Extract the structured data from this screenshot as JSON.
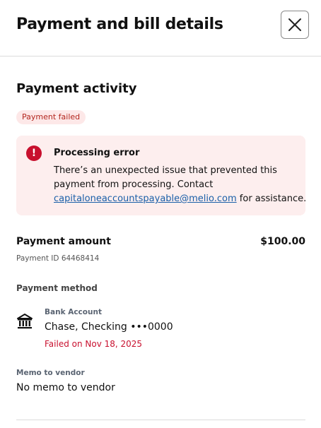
{
  "header": {
    "title": "Payment and bill details"
  },
  "activity": {
    "title": "Payment activity",
    "status_badge": "Payment failed",
    "error": {
      "title": "Processing error",
      "message_line1": "There’s an unexpected issue that prevented this",
      "message_line2": "payment from processing. Contact",
      "contact_email": "capitaloneaccountspayable@melio.com",
      "message_suffix": " for assistance."
    }
  },
  "payment": {
    "amount_label": "Payment amount",
    "amount_value": "$100.00",
    "payment_id": "Payment ID 64468414",
    "method_label": "Payment method",
    "account_type": "Bank Account",
    "account_name": "Chase, Checking •••0000",
    "failed_text": "Failed on Nov 18, 2025"
  },
  "memo": {
    "label": "Memo to vendor",
    "value": "No memo to vendor"
  },
  "icons": {
    "close": "close-icon",
    "error": "error-icon",
    "bank": "bank-icon"
  },
  "colors": {
    "error_red": "#c8102e",
    "error_bg": "#fdeeee",
    "badge_bg": "#fde8e8",
    "link_blue": "#1a5fa8"
  }
}
